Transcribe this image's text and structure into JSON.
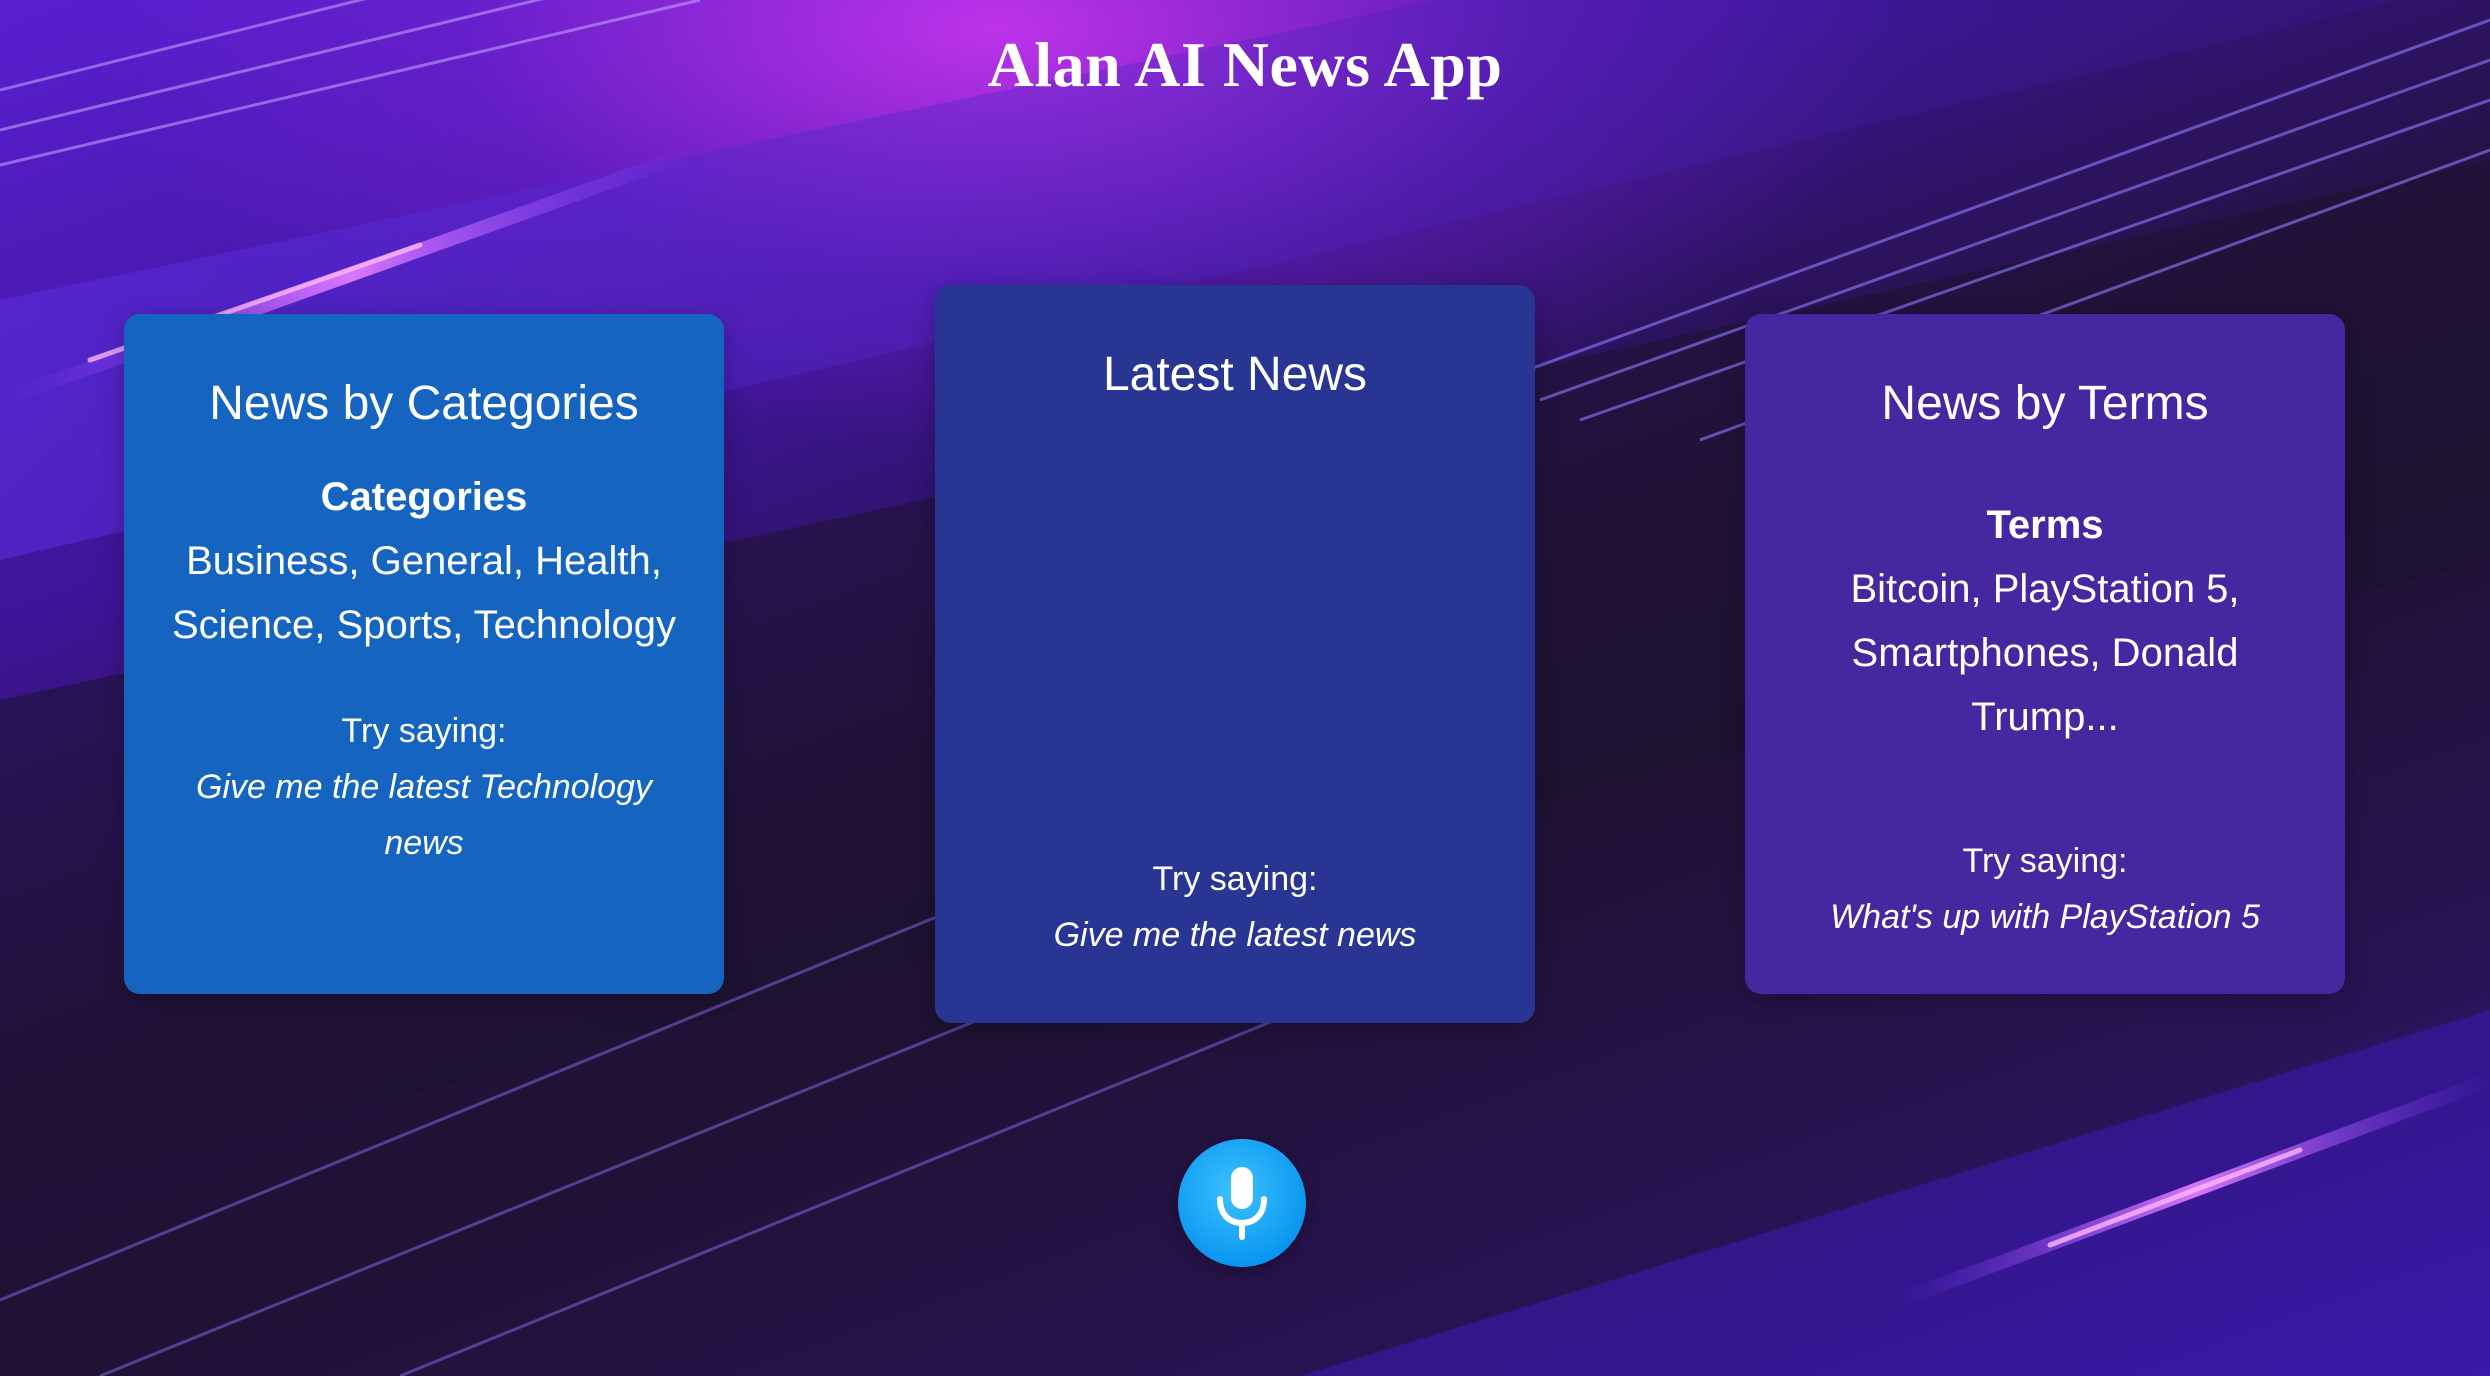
{
  "app": {
    "title": "Alan AI News App"
  },
  "cards": {
    "categories": {
      "title": "News by Categories",
      "list_heading": "Categories",
      "list_text": "Business, General, Health, Science, Sports, Technology",
      "try_label": "Try saying:",
      "try_example": "Give me the latest Technology news"
    },
    "latest": {
      "title": "Latest News",
      "try_label": "Try saying:",
      "try_example": "Give me the latest news"
    },
    "terms": {
      "title": "News by Terms",
      "list_heading": "Terms",
      "list_text": "Bitcoin, PlayStation 5, Smartphones, Donald Trump...",
      "try_label": "Try saying:",
      "try_example": "What's up with PlayStation 5"
    }
  },
  "mic": {
    "icon": "microphone-icon"
  },
  "colors": {
    "categories_card": "#1565c0",
    "latest_card": "#283593",
    "terms_card": "#4527a0",
    "mic_button": "#0b97f0"
  }
}
